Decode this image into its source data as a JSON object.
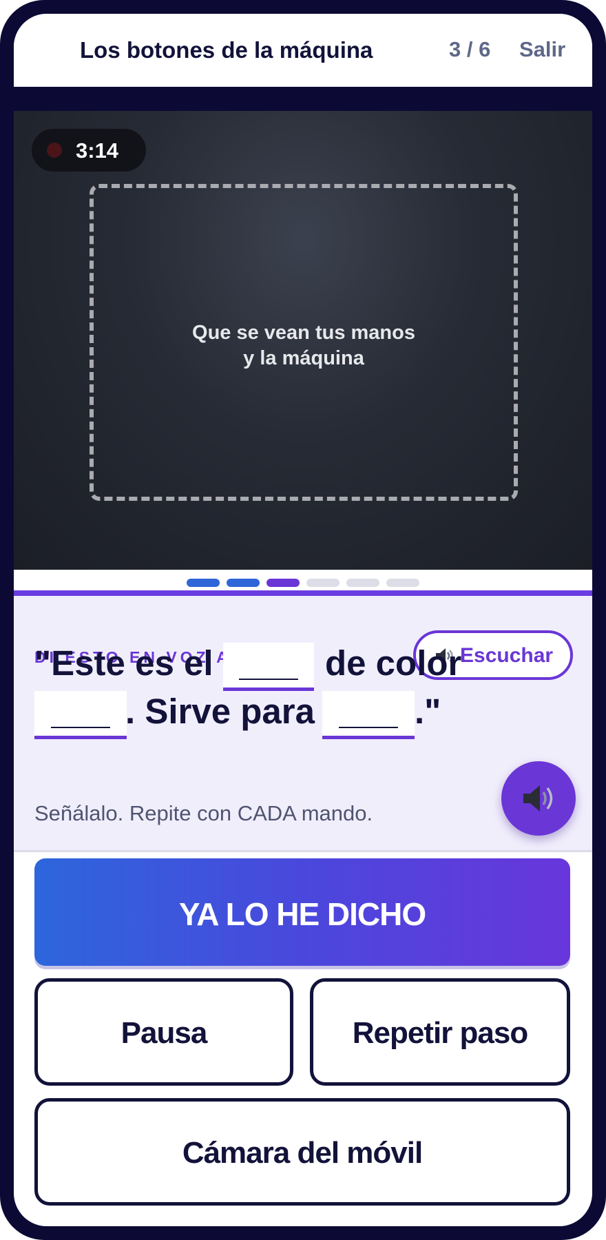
{
  "header": {
    "title": "Los botones de la máquina",
    "step_counter": "3 / 6",
    "exit_label": "Salir"
  },
  "camera": {
    "recording_time": "3:14",
    "frame_hint_line1": "Que se vean tus manos",
    "frame_hint_line2": "y la máquina"
  },
  "progress": {
    "total_steps": 6,
    "current_step": 3,
    "colors": {
      "done": "#2f66d8",
      "current": "#6a36d6",
      "pending": "#dcdde6"
    }
  },
  "prompt": {
    "label": "DI ESTO EN VOZ ALTA",
    "listen_label": "Escuchar",
    "listen_icon": "speaker-icon",
    "sentence": {
      "part1": "\"Este es el",
      "blank1": "___",
      "part2": "de color",
      "blank2": "___",
      "part3": ". Sirve para",
      "blank3": "___",
      "part4": ".\""
    },
    "hint": "Señálalo. Repite con CADA mando.",
    "fab_icon": "speaker-icon"
  },
  "actions": {
    "primary_label": "YA LO HE DICHO",
    "pause_label": "Pausa",
    "repeat_label": "Repetir paso",
    "phone_camera_label": "Cámara del móvil"
  },
  "colors": {
    "frame": "#0c0a34",
    "accent": "#6a36d6",
    "ink": "#12123a",
    "panel_bg": "#f1eefc"
  }
}
